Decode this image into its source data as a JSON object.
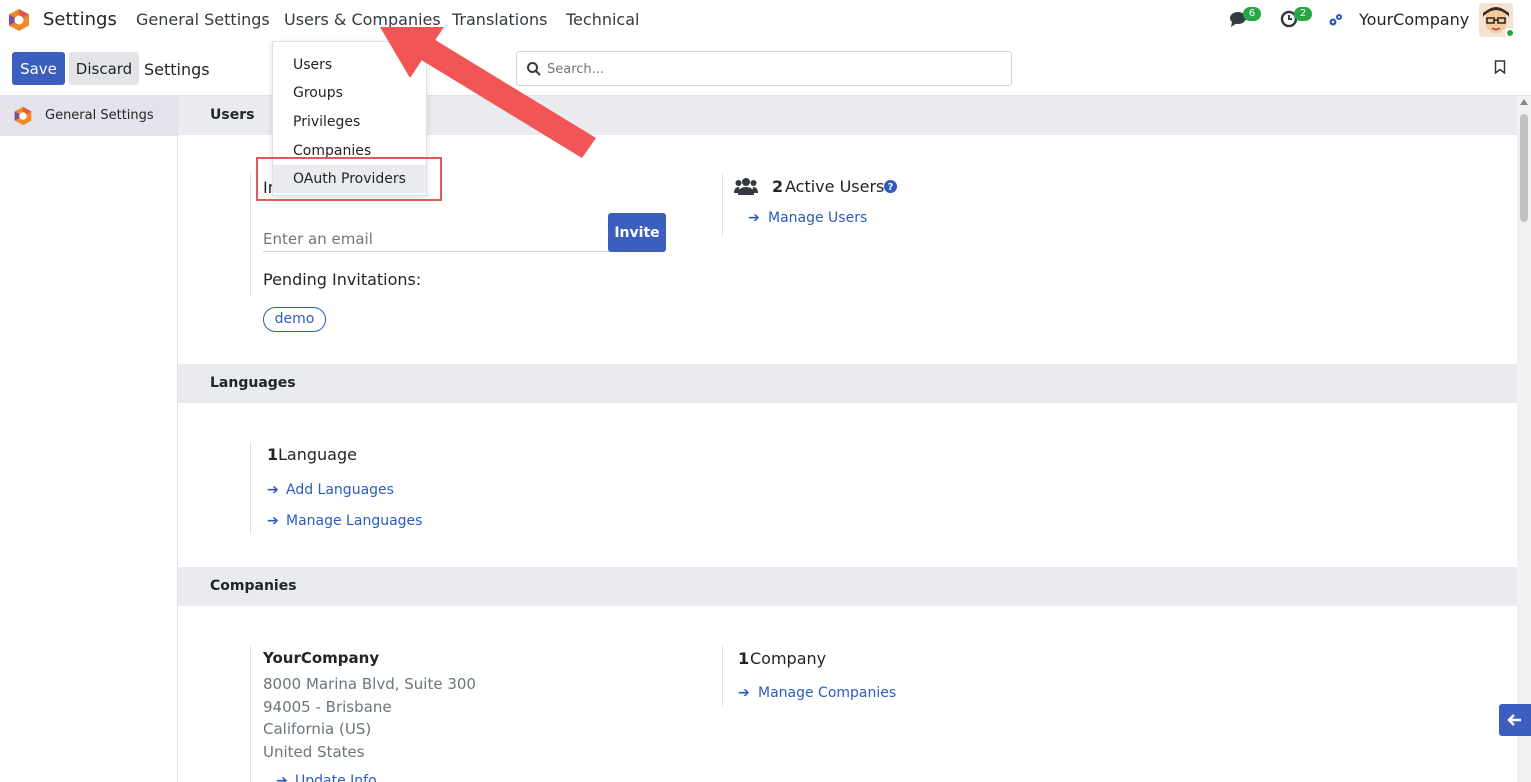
{
  "topnav": {
    "app_name": "Settings",
    "menu": [
      "General Settings",
      "Users & Companies",
      "Translations",
      "Technical"
    ],
    "messages_count": "6",
    "activities_count": "2",
    "company": "YourCompany"
  },
  "control_panel": {
    "save_label": "Save",
    "discard_label": "Discard",
    "title": "Settings",
    "search_placeholder": "Search..."
  },
  "sidebar": {
    "items": [
      {
        "label": "General Settings"
      }
    ]
  },
  "dropdown": {
    "items": [
      "Users",
      "Groups",
      "Privileges",
      "Companies",
      "OAuth Providers"
    ]
  },
  "sections": {
    "users": {
      "title": "Users",
      "invite_label_prefix": "In",
      "email_placeholder": "Enter an email",
      "invite_button": "Invite",
      "pending_label": "Pending Invitations:",
      "pending": [
        "demo"
      ],
      "active_count": "2",
      "active_label": "Active Users",
      "manage_users": "Manage Users"
    },
    "languages": {
      "title": "Languages",
      "count": "1",
      "label": "Language",
      "add": "Add Languages",
      "manage": "Manage Languages"
    },
    "companies": {
      "title": "Companies",
      "company_name": "YourCompany",
      "address_line1": "8000 Marina Blvd, Suite 300",
      "address_line2": "94005 - Brisbane",
      "address_line3": "California (US)",
      "address_line4": "United States",
      "update_info": "Update Info",
      "count": "1",
      "label": "Company",
      "manage": "Manage Companies"
    }
  },
  "colors": {
    "primary": "#3c5fbf",
    "link": "#2b5cbf",
    "highlight": "#e05a5a",
    "badge": "#28a745"
  }
}
